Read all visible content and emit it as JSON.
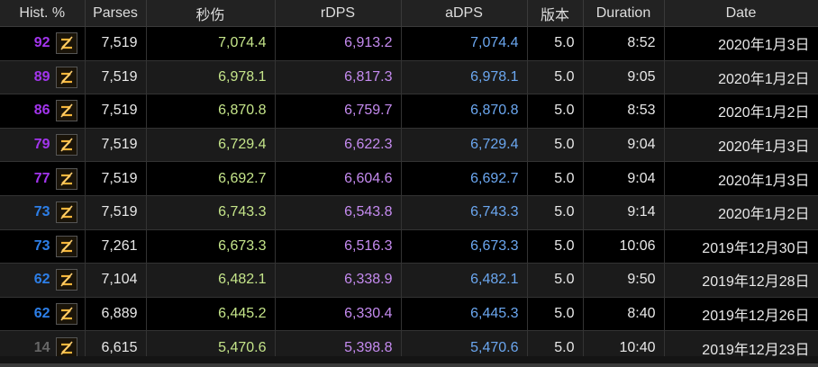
{
  "headers": [
    "Hist. %",
    "Parses",
    "秒伤",
    "rDPS",
    "aDPS",
    "版本",
    "Duration",
    "Date"
  ],
  "colors": {
    "purple": "#a335ee",
    "blue": "#2d7fe8",
    "grey": "#666666"
  },
  "rows": [
    {
      "pct": "92",
      "tier": "purple",
      "parses": "7,519",
      "dps": "7,074.4",
      "rdps": "6,913.2",
      "adps": "7,074.4",
      "ver": "5.0",
      "dur": "8:52",
      "date": "2020年1月3日"
    },
    {
      "pct": "89",
      "tier": "purple",
      "parses": "7,519",
      "dps": "6,978.1",
      "rdps": "6,817.3",
      "adps": "6,978.1",
      "ver": "5.0",
      "dur": "9:05",
      "date": "2020年1月2日"
    },
    {
      "pct": "86",
      "tier": "purple",
      "parses": "7,519",
      "dps": "6,870.8",
      "rdps": "6,759.7",
      "adps": "6,870.8",
      "ver": "5.0",
      "dur": "8:53",
      "date": "2020年1月2日"
    },
    {
      "pct": "79",
      "tier": "purple",
      "parses": "7,519",
      "dps": "6,729.4",
      "rdps": "6,622.3",
      "adps": "6,729.4",
      "ver": "5.0",
      "dur": "9:04",
      "date": "2020年1月3日"
    },
    {
      "pct": "77",
      "tier": "purple",
      "parses": "7,519",
      "dps": "6,692.7",
      "rdps": "6,604.6",
      "adps": "6,692.7",
      "ver": "5.0",
      "dur": "9:04",
      "date": "2020年1月3日"
    },
    {
      "pct": "73",
      "tier": "blue",
      "parses": "7,519",
      "dps": "6,743.3",
      "rdps": "6,543.8",
      "adps": "6,743.3",
      "ver": "5.0",
      "dur": "9:14",
      "date": "2020年1月2日"
    },
    {
      "pct": "73",
      "tier": "blue",
      "parses": "7,261",
      "dps": "6,673.3",
      "rdps": "6,516.3",
      "adps": "6,673.3",
      "ver": "5.0",
      "dur": "10:06",
      "date": "2019年12月30日"
    },
    {
      "pct": "62",
      "tier": "blue",
      "parses": "7,104",
      "dps": "6,482.1",
      "rdps": "6,338.9",
      "adps": "6,482.1",
      "ver": "5.0",
      "dur": "9:50",
      "date": "2019年12月28日"
    },
    {
      "pct": "62",
      "tier": "blue",
      "parses": "6,889",
      "dps": "6,445.2",
      "rdps": "6,330.4",
      "adps": "6,445.3",
      "ver": "5.0",
      "dur": "8:40",
      "date": "2019年12月26日"
    },
    {
      "pct": "14",
      "tier": "grey",
      "parses": "6,615",
      "dps": "5,470.6",
      "rdps": "5,398.8",
      "adps": "5,470.6",
      "ver": "5.0",
      "dur": "10:40",
      "date": "2019年12月23日"
    }
  ]
}
